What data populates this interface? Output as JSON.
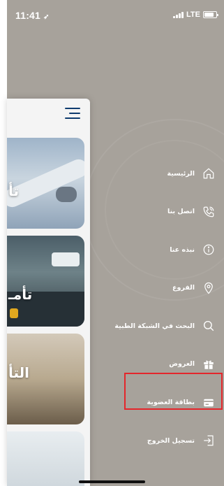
{
  "status_bar": {
    "time": "11:41",
    "network": "LTE"
  },
  "content": {
    "cards": [
      {
        "title": "تأ"
      },
      {
        "title": "تأمـ"
      },
      {
        "title": "التأ"
      },
      {
        "title": ""
      }
    ]
  },
  "menu": {
    "items": [
      {
        "label": "الرئيسية",
        "icon": "home-icon"
      },
      {
        "label": "اتصل بنا",
        "icon": "phone-icon"
      },
      {
        "label": "نبذه عنا",
        "icon": "info-icon"
      },
      {
        "label": "الفروع",
        "icon": "location-pin-icon"
      },
      {
        "label": "البحث في الشبكة الطبية",
        "icon": "search-icon"
      },
      {
        "label": "العروض",
        "icon": "gift-icon"
      },
      {
        "label": "بطاقة العضوية",
        "icon": "card-icon"
      },
      {
        "label": "تسجيل الخروج",
        "icon": "logout-icon"
      }
    ]
  },
  "colors": {
    "drawer_background": "#a7a29b",
    "highlight": "#e4262b",
    "hamburger": "#0e3b6e"
  }
}
